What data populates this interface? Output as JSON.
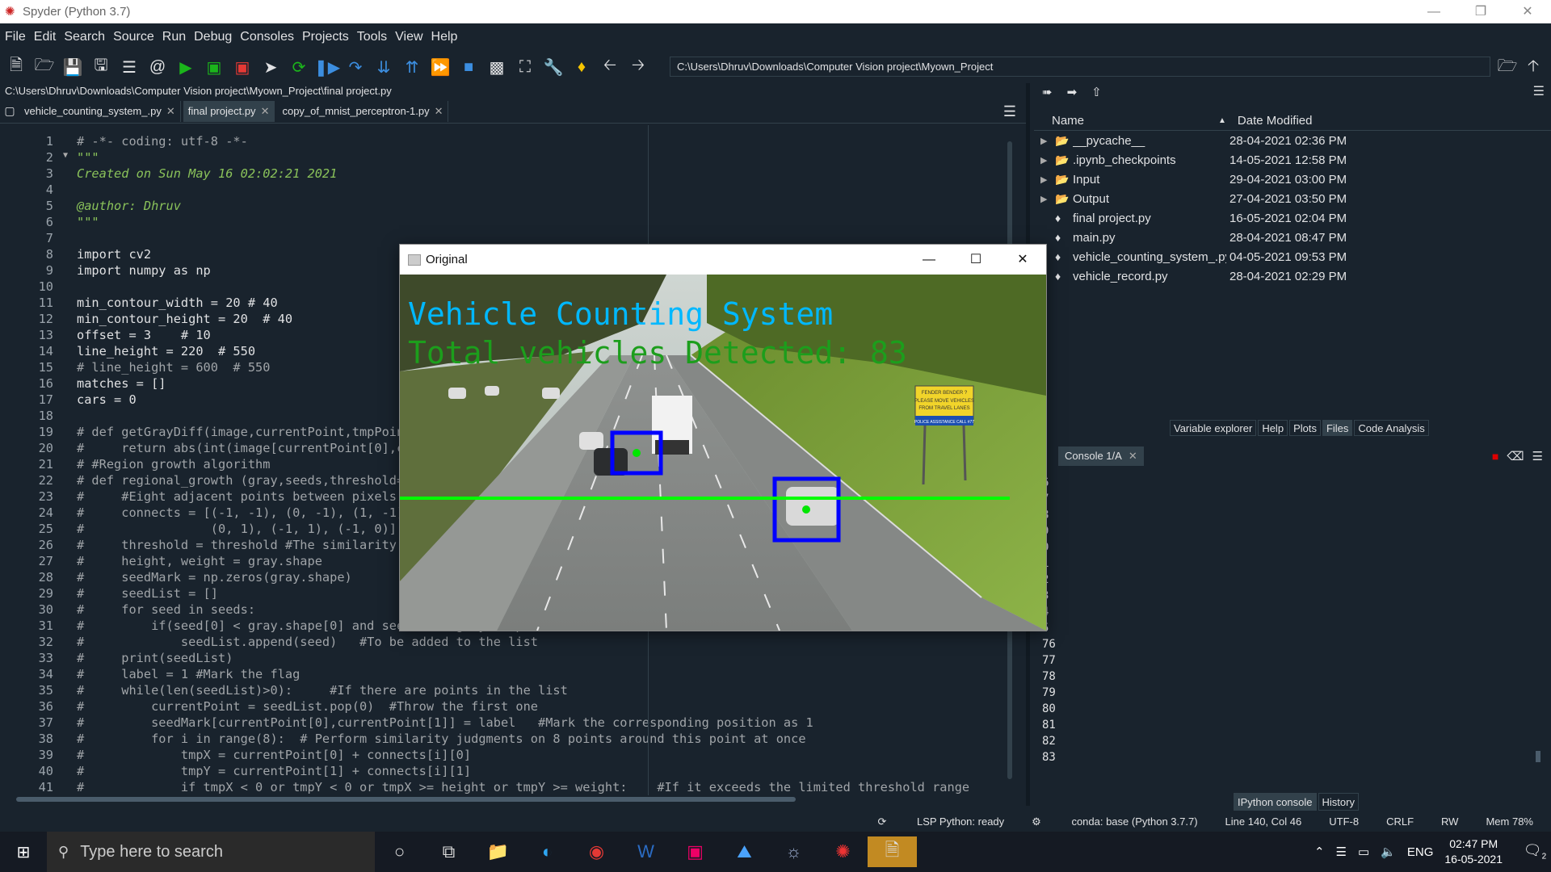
{
  "app": {
    "title": "Spyder (Python 3.7)"
  },
  "menu": [
    "File",
    "Edit",
    "Search",
    "Source",
    "Run",
    "Debug",
    "Consoles",
    "Projects",
    "Tools",
    "View",
    "Help"
  ],
  "toolbar": {
    "path": "C:\\Users\\Dhruv\\Downloads\\Computer Vision project\\Myown_Project"
  },
  "editor": {
    "filepath": "C:\\Users\\Dhruv\\Downloads\\Computer Vision project\\Myown_Project\\final project.py",
    "tabs": [
      {
        "label": "vehicle_counting_system_.py"
      },
      {
        "label": "final project.py"
      },
      {
        "label": "copy_of_mnist_perceptron-1.py"
      }
    ],
    "line_numbers": [
      "1",
      "2",
      "3",
      "4",
      "5",
      "6",
      "7",
      "8",
      "9",
      "10",
      "11",
      "12",
      "13",
      "14",
      "15",
      "16",
      "17",
      "18",
      "19",
      "20",
      "21",
      "22",
      "23",
      "24",
      "25",
      "26",
      "27",
      "28",
      "29",
      "30",
      "31",
      "32",
      "33",
      "34",
      "35",
      "36",
      "37",
      "38",
      "39",
      "40",
      "41"
    ],
    "lines": [
      "# -*- coding: utf-8 -*-",
      "\"\"\"",
      "Created on Sun May 16 02:02:21 2021",
      "",
      "@author: Dhruv",
      "\"\"\"",
      "",
      "import cv2",
      "import numpy as np",
      "",
      "min_contour_width = 20 # 40",
      "min_contour_height = 20  # 40",
      "offset = 3    # 10",
      "line_height = 220  # 550",
      "# line_height = 600  # 550",
      "matches = []",
      "cars = 0",
      "",
      "# def getGrayDiff(image,currentPoint,tmpPoint):",
      "#     return abs(int(image[currentPoint[0],currentPoint[1]]) - int(image[tmpPoint[0],tmpPoint[1]]))",
      "# #Region growth algorithm",
      "# def regional_growth (gray,seeds,threshold=5) :",
      "#     #Eight adjacent points between pixels",
      "#     connects = [(-1, -1), (0, -1), (1, -1), (1, 0), (1, 1), \\",
      "#                 (0, 1), (-1, 1), (-1, 0)]",
      "#     threshold = threshold #The similarity threshold",
      "#     height, weight = gray.shape",
      "#     seedMark = np.zeros(gray.shape)",
      "#     seedList = []",
      "#     for seed in seeds:",
      "#         if(seed[0] < gray.shape[0] and seed[1] < gray.shape[1] and seed[0] > 0 and seed[1] > 0):",
      "#             seedList.append(seed)   #To be added to the list",
      "#     print(seedList)",
      "#     label = 1 #Mark the flag",
      "#     while(len(seedList)>0):     #If there are points in the list",
      "#         currentPoint = seedList.pop(0)  #Throw the first one",
      "#         seedMark[currentPoint[0],currentPoint[1]] = label   #Mark the corresponding position as 1",
      "#         for i in range(8):  # Perform similarity judgments on 8 points around this point at once",
      "#             tmpX = currentPoint[0] + connects[i][0]",
      "#             tmpY = currentPoint[1] + connects[i][1]",
      "#             if tmpX < 0 or tmpY < 0 or tmpX >= height or tmpY >= weight:    #If it exceeds the limited threshold range"
    ]
  },
  "files": {
    "col_name": "Name",
    "col_date": "Date Modified",
    "rows": [
      {
        "name": "__pycache__",
        "date": "28-04-2021 02:36 PM",
        "type": "folder"
      },
      {
        "name": ".ipynb_checkpoints",
        "date": "14-05-2021 12:58 PM",
        "type": "folder"
      },
      {
        "name": "Input",
        "date": "29-04-2021 03:00 PM",
        "type": "folder"
      },
      {
        "name": "Output",
        "date": "27-04-2021 03:50 PM",
        "type": "folder"
      },
      {
        "name": "final project.py",
        "date": "16-05-2021 02:04 PM",
        "type": "file"
      },
      {
        "name": "main.py",
        "date": "28-04-2021 08:47 PM",
        "type": "file"
      },
      {
        "name": "vehicle_counting_system_.py",
        "date": "04-05-2021 09:53 PM",
        "type": "file"
      },
      {
        "name": "vehicle_record.py",
        "date": "28-04-2021 02:29 PM",
        "type": "file"
      }
    ]
  },
  "pane_tabs": [
    "Variable explorer",
    "Help",
    "Plots",
    "Files",
    "Code Analysis"
  ],
  "console": {
    "tab": "Console 1/A",
    "lines": [
      "6",
      "7",
      "8",
      "9",
      "0",
      "1",
      "2",
      "3",
      "4",
      "5",
      "76",
      "77",
      "78",
      "79",
      "80",
      "81",
      "82",
      "83"
    ],
    "bottom_tabs": [
      "IPython console",
      "History"
    ]
  },
  "status": {
    "lsp": "LSP Python: ready",
    "conda": "conda: base (Python 3.7.7)",
    "position": "Line 140, Col 46",
    "encoding": "UTF-8",
    "eol": "CRLF",
    "mode": "RW",
    "mem": "Mem 78%"
  },
  "taskbar": {
    "search_placeholder": "Type here to search",
    "lang": "ENG",
    "time": "02:47 PM",
    "date": "16-05-2021",
    "notif_count": "2"
  },
  "video": {
    "window_title": "Original",
    "heading": "Vehicle Counting System",
    "count_text": "Total vehicles Detected: 83",
    "sign_line1": "FENDER BENDER ?",
    "sign_line2": "PLEASE MOVE VEHICLES",
    "sign_line3": "FROM TRAVEL LANES",
    "sign_line4": "POLICE ASSISTANCE CALL #77"
  },
  "colors": {
    "bg": "#19232d",
    "accent": "#32414b",
    "heading": "#00b8ff",
    "count": "#1c9e1c",
    "box": "#0000ff",
    "line": "#00ff00"
  }
}
